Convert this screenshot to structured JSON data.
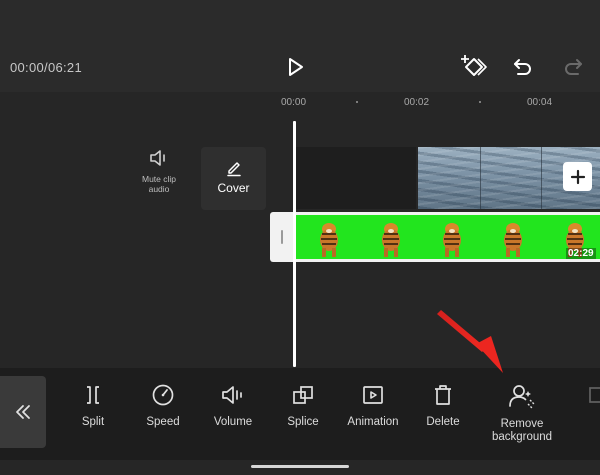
{
  "topbar": {
    "timecode": "00:00/06:21",
    "play_icon": "play-icon",
    "keyframe_icon": "keyframe-add-icon",
    "undo_icon": "undo-icon",
    "redo_icon": "redo-icon"
  },
  "ruler": {
    "labels": [
      "00:00",
      "00:02",
      "00:04"
    ]
  },
  "track_controls": {
    "mute_label": "Mute clip audio",
    "cover_label": "Cover"
  },
  "clips": {
    "green_clip_duration": "02:29"
  },
  "toolbar": {
    "back_icon": "double-chevron-left-icon",
    "tools": [
      {
        "label": "Split",
        "icon": "split-icon"
      },
      {
        "label": "Speed",
        "icon": "speed-icon"
      },
      {
        "label": "Volume",
        "icon": "volume-icon"
      },
      {
        "label": "Splice",
        "icon": "splice-icon"
      },
      {
        "label": "Animation",
        "icon": "animation-icon"
      },
      {
        "label": "Delete",
        "icon": "trash-icon"
      },
      {
        "label_line1": "Remove",
        "label_line2": "background",
        "icon": "remove-background-icon"
      }
    ]
  },
  "colors": {
    "accent_green": "#22e51e",
    "annotation_arrow": "#e52420"
  }
}
